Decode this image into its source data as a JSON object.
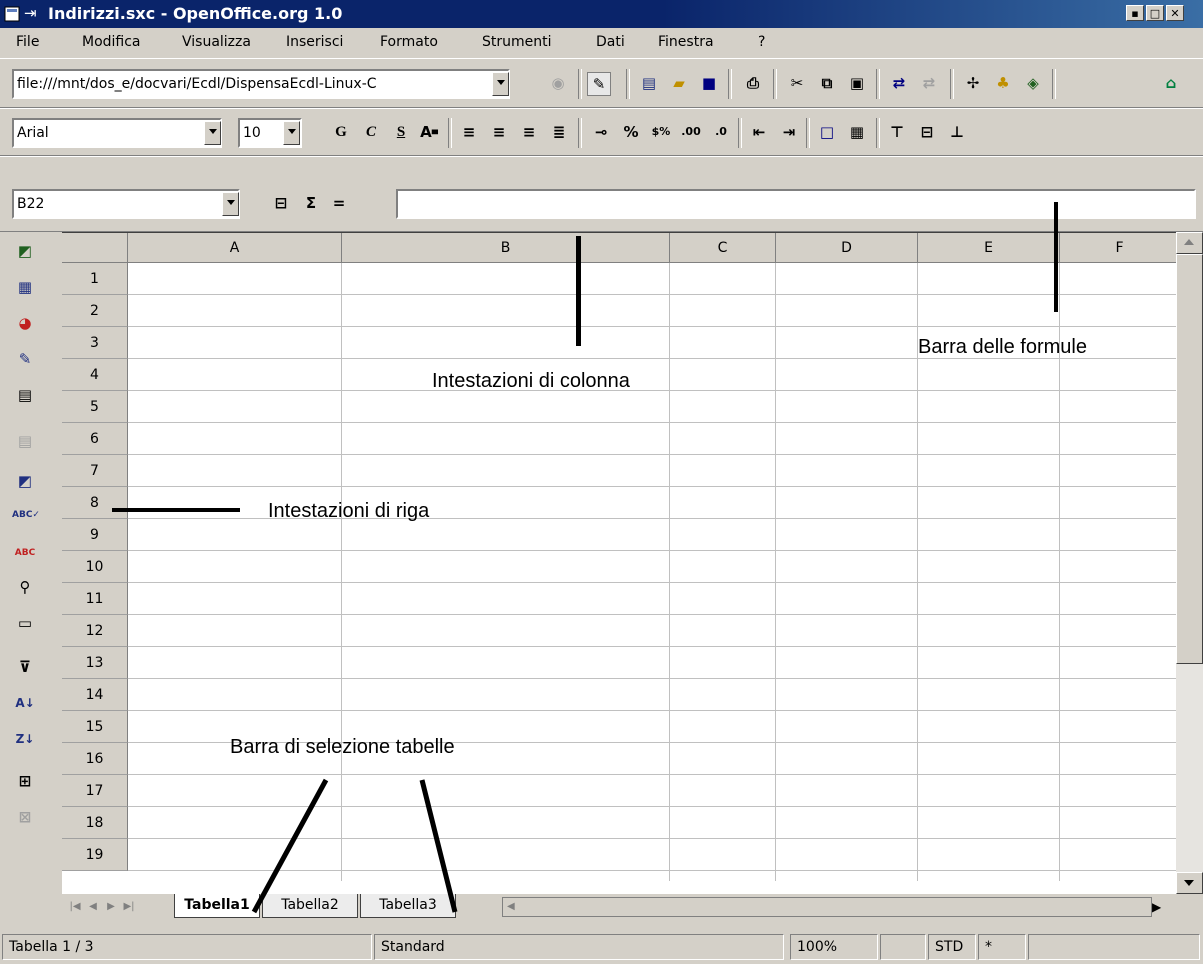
{
  "window": {
    "title": "Indirizzi.sxc - OpenOffice.org 1.0"
  },
  "menu": [
    "File",
    "Modifica",
    "Visualizza",
    "Inserisci",
    "Formato",
    "Strumenti",
    "Dati",
    "Finestra",
    "?"
  ],
  "function_bar": {
    "url": "file:///mnt/dos_e/docvari/Ecdl/DispensaEcdl-Linux-C"
  },
  "object_bar": {
    "font_name": "Arial",
    "font_size": "10",
    "bold": "G",
    "italic": "C",
    "underline": "S"
  },
  "formula_bar": {
    "cell_ref": "B22",
    "sum_symbol": "Σ",
    "equals_symbol": "=",
    "formula": ""
  },
  "grid": {
    "columns": [
      "A",
      "B",
      "C",
      "D",
      "E",
      "F"
    ],
    "rows": [
      "1",
      "2",
      "3",
      "4",
      "5",
      "6",
      "7",
      "8",
      "9",
      "10",
      "11",
      "12",
      "13",
      "14",
      "15",
      "16",
      "17",
      "18",
      "19"
    ]
  },
  "sheet_tabs": [
    "Tabella1",
    "Tabella2",
    "Tabella3"
  ],
  "active_sheet": "Tabella1",
  "status_bar": {
    "sheet": "Tabella 1 / 3",
    "page_style": "Standard",
    "zoom": "100%",
    "mode": "STD",
    "modified": "*"
  },
  "annotations": {
    "formula_bar": "Barra delle formule",
    "column_headers": "Intestazioni di colonna",
    "row_headers": "Intestazioni di riga",
    "sheet_tabs": "Barra di selezione tabelle"
  }
}
